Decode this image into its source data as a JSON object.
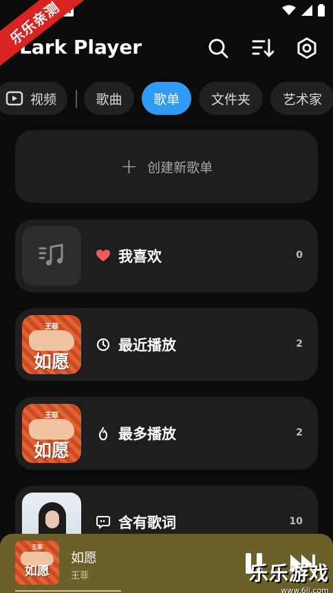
{
  "status_bar": {
    "badge": "A",
    "icons": [
      "wifi-icon",
      "signal-icon",
      "battery-icon"
    ]
  },
  "ribbon": {
    "text": "乐乐亲测"
  },
  "header": {
    "title": "Lark Player"
  },
  "tabs": [
    {
      "label": "视频",
      "icon": "video-icon"
    },
    {
      "label": "歌曲"
    },
    {
      "label": "歌单",
      "active": true
    },
    {
      "label": "文件夹"
    },
    {
      "label": "艺术家"
    }
  ],
  "create_playlist": {
    "label": "创建新歌单"
  },
  "playlists": [
    {
      "name": "我喜欢",
      "count": "0",
      "icon": "heart-icon"
    },
    {
      "name": "最近播放",
      "count": "2",
      "icon": "clock-icon",
      "cover_top": "王菲",
      "cover_title": "如愿"
    },
    {
      "name": "最多播放",
      "count": "2",
      "icon": "flame-icon",
      "cover_top": "王菲",
      "cover_title": "如愿"
    },
    {
      "name": "含有歌词",
      "count": "10",
      "icon": "lyrics-icon"
    }
  ],
  "mini_player": {
    "title": "如愿",
    "artist": "王菲",
    "cover_top": "王菲",
    "cover_title": "如愿",
    "progress": 0.35
  },
  "watermark": {
    "line1": "乐乐游戏",
    "line2": "www.6ll.com"
  },
  "colors": {
    "accent": "#2f9bf5",
    "heart": "#f05a5a",
    "mini_player_bg": "#6b5f2a"
  }
}
